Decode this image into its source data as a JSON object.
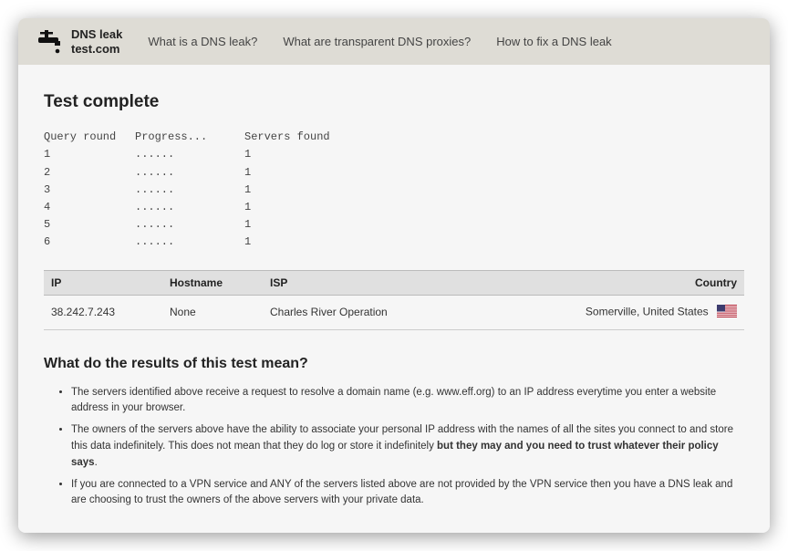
{
  "logo": {
    "line1": "DNS leak",
    "line2": "test.com"
  },
  "nav": {
    "what_is": "What is a DNS leak?",
    "transparent_proxies": "What are transparent DNS proxies?",
    "how_to_fix": "How to fix a DNS leak"
  },
  "test_complete": "Test complete",
  "query_header": {
    "round": "Query round",
    "progress": "Progress...",
    "found": "Servers found"
  },
  "query_rows": [
    {
      "round": "1",
      "progress": "......",
      "found": "1"
    },
    {
      "round": "2",
      "progress": "......",
      "found": "1"
    },
    {
      "round": "3",
      "progress": "......",
      "found": "1"
    },
    {
      "round": "4",
      "progress": "......",
      "found": "1"
    },
    {
      "round": "5",
      "progress": "......",
      "found": "1"
    },
    {
      "round": "6",
      "progress": "......",
      "found": "1"
    }
  ],
  "results": {
    "headers": {
      "ip": "IP",
      "hostname": "Hostname",
      "isp": "ISP",
      "country": "Country"
    },
    "rows": [
      {
        "ip": "38.242.7.243",
        "hostname": "None",
        "isp": "Charles River Operation",
        "country": "Somerville, United States"
      }
    ]
  },
  "explain": {
    "title": "What do the results of this test mean?",
    "items": [
      {
        "pre": "The servers identified above receive a request to resolve a domain name (e.g. www.eff.org) to an IP address everytime you enter a website address in your browser.",
        "bold": "",
        "post": ""
      },
      {
        "pre": "The owners of the servers above have the ability to associate your personal IP address with the names of all the sites you connect to and store this data indefinitely. This does not mean that they do log or store it indefinitely ",
        "bold": "but they may and you need to trust whatever their policy says",
        "post": "."
      },
      {
        "pre": "If you are connected to a VPN service and ANY of the servers listed above are not provided by the VPN service then you have a DNS leak and are choosing to trust the owners of the above servers with your private data.",
        "bold": "",
        "post": ""
      }
    ]
  }
}
